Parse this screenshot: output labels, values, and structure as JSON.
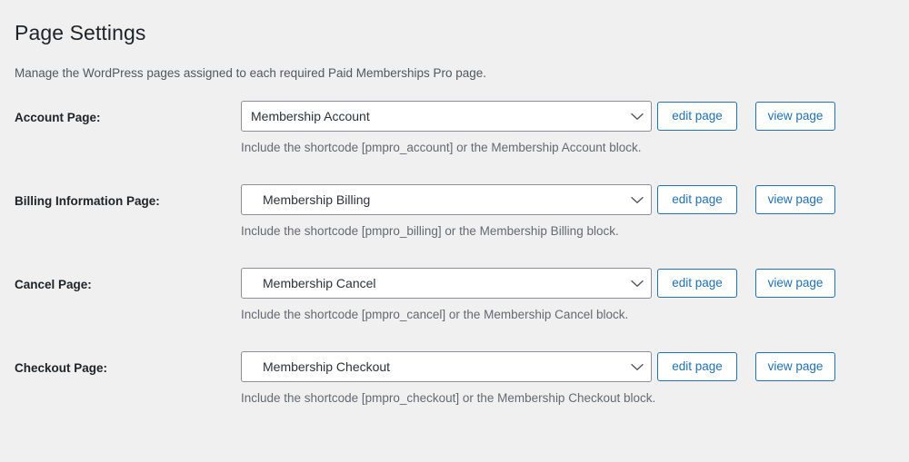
{
  "header": {
    "title": "Page Settings",
    "subtitle": "Manage the WordPress pages assigned to each required Paid Memberships Pro page."
  },
  "buttons": {
    "edit_label": "edit page",
    "view_label": "view page"
  },
  "icons": {
    "chevron": "chevron-down-icon"
  },
  "colors": {
    "background": "#f0f0f1",
    "accent_blue": "#2271b1",
    "text_dark": "#1d2327",
    "text_muted": "#646970",
    "select_border": "#8c8f94",
    "select_background": "#ffffff"
  },
  "rows": [
    {
      "label": "Account Page:",
      "selected": "Membership Account",
      "help": "Include the shortcode [pmpro_account] or the Membership Account block."
    },
    {
      "label": "Billing Information Page:",
      "selected": "Membership Billing",
      "help": "Include the shortcode [pmpro_billing] or the Membership Billing block."
    },
    {
      "label": "Cancel Page:",
      "selected": "Membership Cancel",
      "help": "Include the shortcode [pmpro_cancel] or the Membership Cancel block."
    },
    {
      "label": "Checkout Page:",
      "selected": "Membership Checkout",
      "help": "Include the shortcode [pmpro_checkout] or the Membership Checkout block."
    }
  ]
}
